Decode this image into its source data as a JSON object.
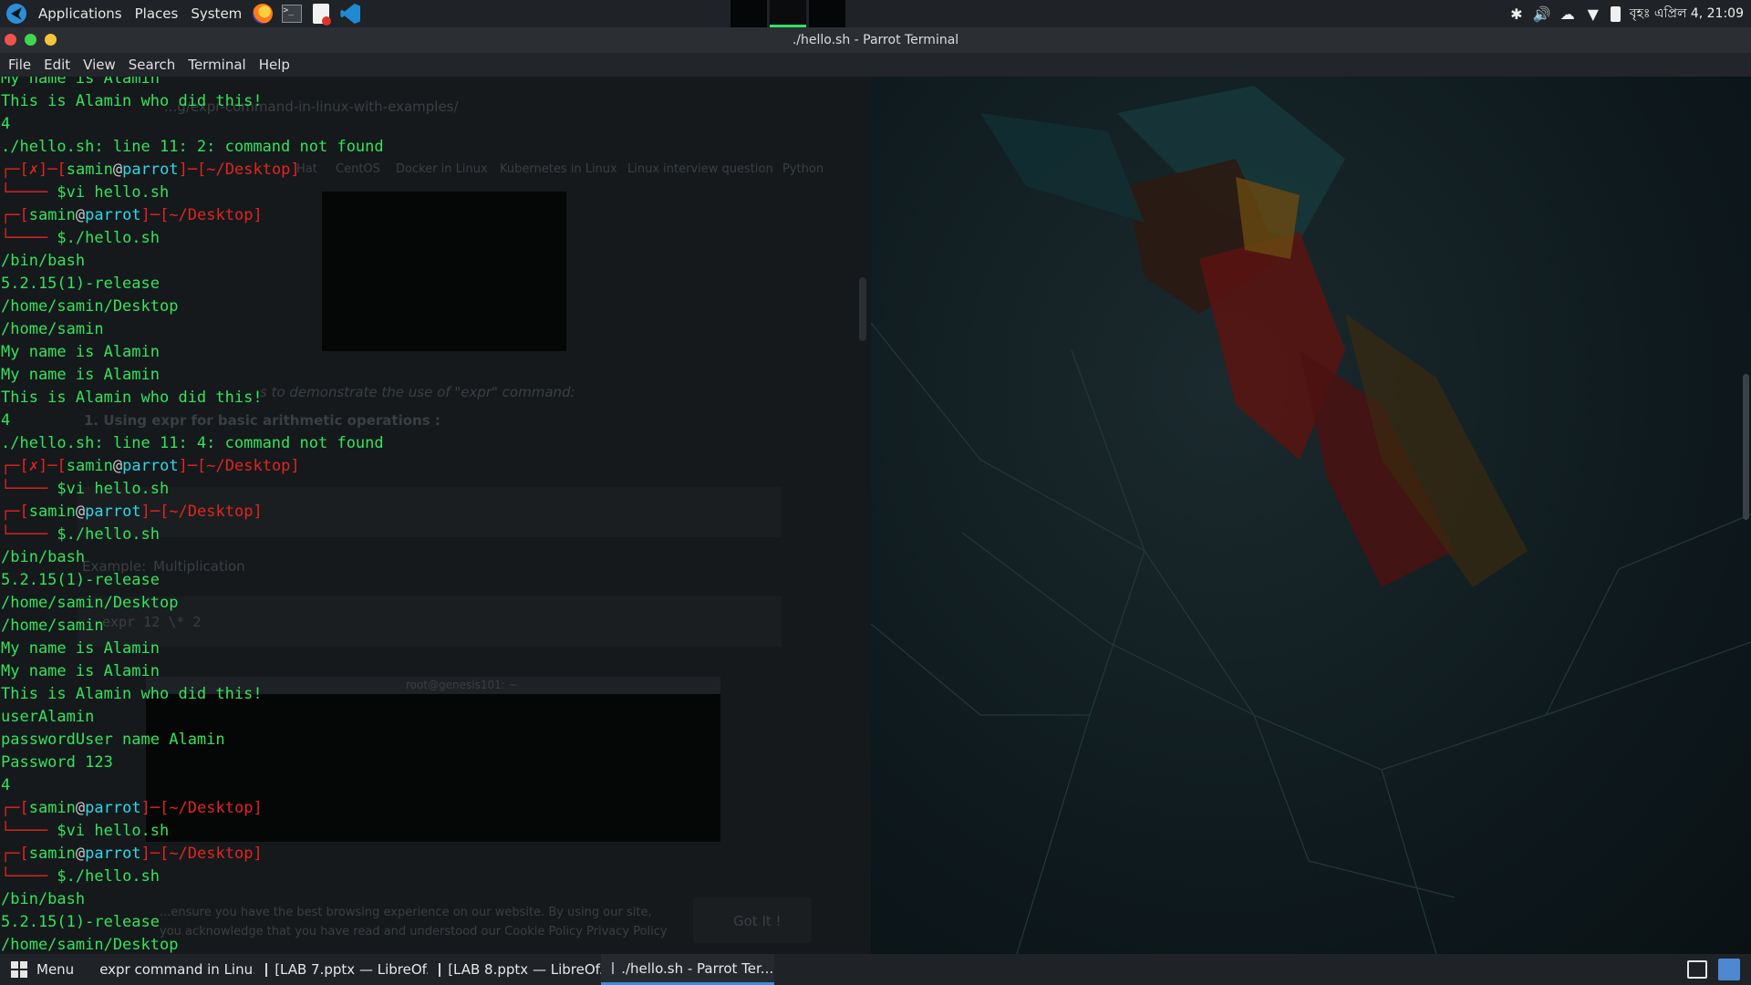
{
  "top_panel": {
    "menus": [
      "Applications",
      "Places",
      "System"
    ],
    "launchers": [
      "firefox-icon",
      "terminal-icon",
      "document-viewer-icon",
      "vscode-icon"
    ],
    "clock": "বৃহঃ এপ্রিল 4, 21:09",
    "tray_icons": [
      "bluetooth-icon",
      "volume-icon",
      "cloud-icon",
      "wifi-icon",
      "battery-icon"
    ]
  },
  "window": {
    "title": "./hello.sh - Parrot Terminal",
    "menu": [
      "File",
      "Edit",
      "View",
      "Search",
      "Terminal",
      "Help"
    ]
  },
  "terminal": {
    "lines": [
      {
        "t": "out",
        "text": "My name is Alamin"
      },
      {
        "t": "out",
        "text": "This is Alamin who did this!"
      },
      {
        "t": "out",
        "text": "4"
      },
      {
        "t": "out",
        "text": "./hello.sh: line 11: 2: command not found"
      },
      {
        "t": "prompt",
        "err": true,
        "user": "samin",
        "host": "parrot",
        "path": "~/Desktop"
      },
      {
        "t": "cmd",
        "text": "vi hello.sh"
      },
      {
        "t": "prompt",
        "err": false,
        "user": "samin",
        "host": "parrot",
        "path": "~/Desktop"
      },
      {
        "t": "cmd",
        "text": "./hello.sh"
      },
      {
        "t": "out",
        "text": "/bin/bash"
      },
      {
        "t": "out",
        "text": "5.2.15(1)-release"
      },
      {
        "t": "out",
        "text": "/home/samin/Desktop"
      },
      {
        "t": "out",
        "text": "/home/samin"
      },
      {
        "t": "out",
        "text": "My name is Alamin"
      },
      {
        "t": "out",
        "text": "My name is Alamin"
      },
      {
        "t": "out",
        "text": "This is Alamin who did this!"
      },
      {
        "t": "out",
        "text": "4"
      },
      {
        "t": "out",
        "text": "./hello.sh: line 11: 4: command not found"
      },
      {
        "t": "prompt",
        "err": true,
        "user": "samin",
        "host": "parrot",
        "path": "~/Desktop"
      },
      {
        "t": "cmd",
        "text": "vi hello.sh"
      },
      {
        "t": "prompt",
        "err": false,
        "user": "samin",
        "host": "parrot",
        "path": "~/Desktop"
      },
      {
        "t": "cmd",
        "text": "./hello.sh"
      },
      {
        "t": "out",
        "text": "/bin/bash"
      },
      {
        "t": "out",
        "text": "5.2.15(1)-release"
      },
      {
        "t": "out",
        "text": "/home/samin/Desktop"
      },
      {
        "t": "out",
        "text": "/home/samin"
      },
      {
        "t": "out",
        "text": "My name is Alamin"
      },
      {
        "t": "out",
        "text": "My name is Alamin"
      },
      {
        "t": "out",
        "text": "This is Alamin who did this!"
      },
      {
        "t": "out",
        "text": "userAlamin"
      },
      {
        "t": "out",
        "text": "passwordUser name Alamin"
      },
      {
        "t": "out",
        "text": "Password 123"
      },
      {
        "t": "out",
        "text": "4"
      },
      {
        "t": "prompt",
        "err": false,
        "user": "samin",
        "host": "parrot",
        "path": "~/Desktop"
      },
      {
        "t": "cmd",
        "text": "vi hello.sh"
      },
      {
        "t": "prompt",
        "err": false,
        "user": "samin",
        "host": "parrot",
        "path": "~/Desktop"
      },
      {
        "t": "cmd",
        "text": "./hello.sh"
      },
      {
        "t": "out",
        "text": "/bin/bash"
      },
      {
        "t": "out",
        "text": "5.2.15(1)-release"
      },
      {
        "t": "out",
        "text": "/home/samin/Desktop"
      }
    ]
  },
  "background_window": {
    "url": "...g/expr-command-in-linux-with-examples/",
    "nav": [
      "Hat",
      "CentOS",
      "Docker in Linux",
      "Kubernetes in Linux",
      "Linux interview question",
      "Python"
    ],
    "caption": "s to demonstrate the use of \"expr\" command:",
    "heading": "1. Using expr for basic arithmetic operations :",
    "example_label": "Example:",
    "example_title": "Multiplication",
    "example_cmd": "expr 12 \\* 2",
    "inner_title": "root@genesis101: ~",
    "cookie_text": "...ensure you have the best browsing experience on our website. By using our site, you acknowledge that you have read and understood our",
    "cookie_policy": "Cookie Policy",
    "privacy_policy": "Privacy Policy",
    "got_it": "Got It !"
  },
  "taskbar": {
    "menu_label": "Menu",
    "tasks": [
      {
        "icon": "chrome-icon",
        "label": "expr command in Linu..."
      },
      {
        "icon": "libreoffice-icon",
        "label": "[LAB 7.pptx — LibreOf..."
      },
      {
        "icon": "libreoffice-icon",
        "label": "[LAB 8.pptx — LibreOf..."
      },
      {
        "icon": "terminal-icon",
        "label": "./hello.sh - Parrot Ter..."
      }
    ]
  },
  "colors": {
    "terminal_text": "#34e35b",
    "prompt_bracket": "#e3241f",
    "prompt_host": "#2fd8e6",
    "taskbar_active": "#3b8ce0"
  }
}
